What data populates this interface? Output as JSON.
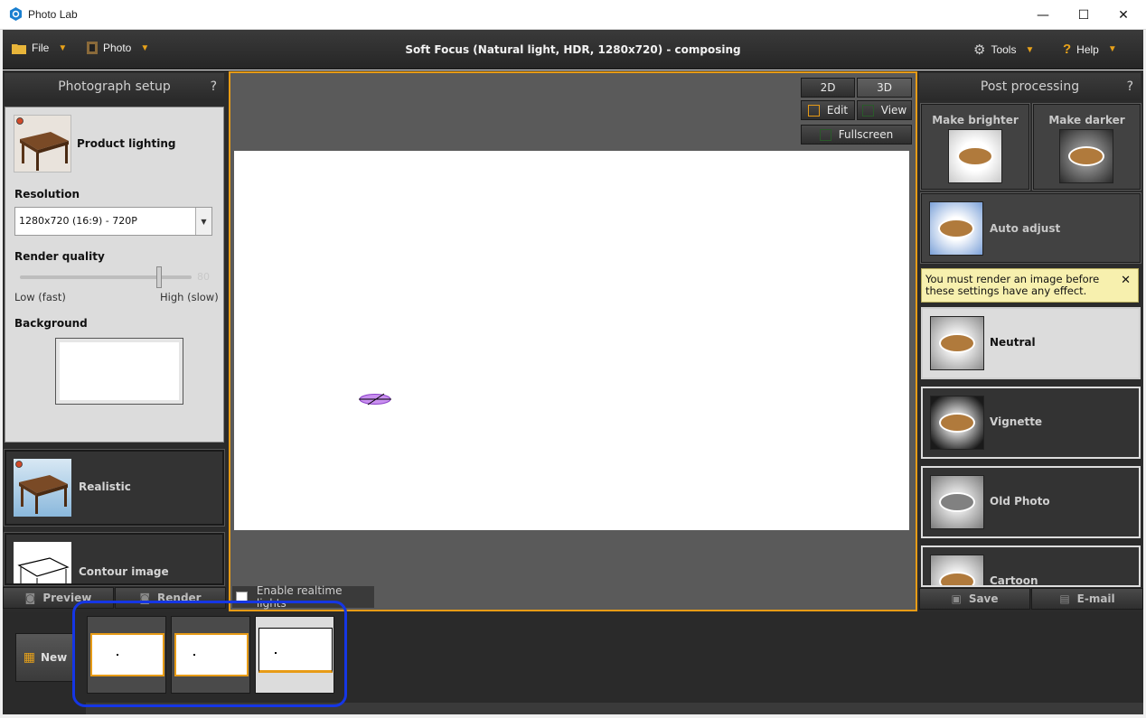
{
  "window": {
    "title": "Photo Lab",
    "minimize": "—",
    "maximize": "☐",
    "close": "✕"
  },
  "menubar": {
    "file": "File",
    "photo": "Photo",
    "doc_title": "Soft Focus (Natural light, HDR, 1280x720) - composing",
    "tools": "Tools",
    "help": "Help"
  },
  "left_panel": {
    "title": "Photograph setup",
    "help": "?",
    "lighting_label": "Product lighting",
    "resolution_label": "Resolution",
    "resolution_value": "1280x720 (16:9) - 720P",
    "render_quality_label": "Render quality",
    "render_quality_value": "80",
    "render_quality_level": 0.8,
    "quality_low": "Low (fast)",
    "quality_high": "High (slow)",
    "background_label": "Background",
    "styles": [
      "Realistic",
      "Contour image"
    ],
    "preview": "Preview",
    "render": "Render"
  },
  "viewport": {
    "btn_2d": "2D",
    "btn_3d": "3D",
    "btn_edit": "Edit",
    "btn_view": "View",
    "btn_fullscreen": "Fullscreen",
    "realtime_lights": "Enable realtime lights",
    "accent": "#e79b16"
  },
  "right_panel": {
    "title": "Post processing",
    "help": "?",
    "brighter": "Make brighter",
    "darker": "Make darker",
    "auto_adjust": "Auto adjust",
    "tooltip": "You must render an image before these settings have any effect.",
    "tooltip_close": "✕",
    "filters": [
      "Neutral",
      "Vignette",
      "Old Photo",
      "Cartoon"
    ],
    "save": "Save",
    "email": "E-mail"
  },
  "strip": {
    "new": "New"
  },
  "colors": {
    "highlight": "#1536e5",
    "tooltip_bg": "#f7f0ae"
  }
}
